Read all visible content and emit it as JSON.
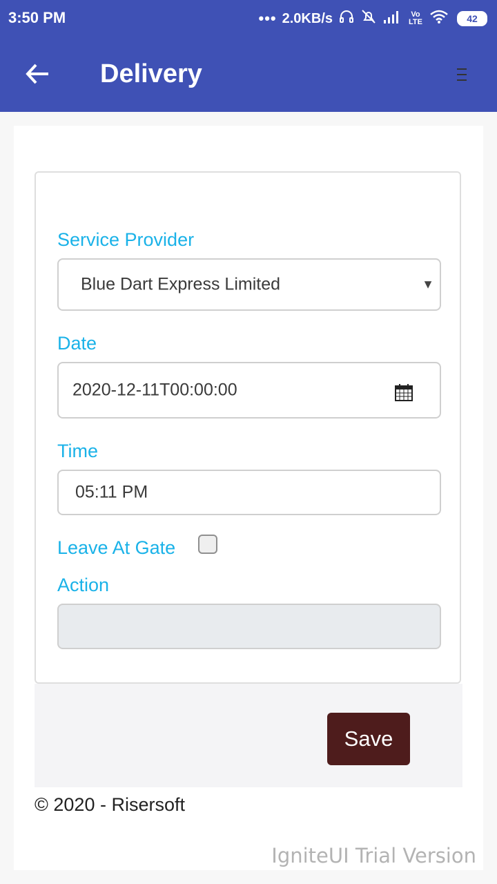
{
  "status_bar": {
    "time": "3:50 PM",
    "dots": "•••",
    "network_speed": "2.0KB/s",
    "icons": [
      "headset-icon",
      "mute-icon",
      "signal-icon",
      "volte-icon",
      "wifi-icon"
    ],
    "volte_label": "Vo LTE",
    "battery": "42"
  },
  "app_bar": {
    "title": "Delivery",
    "back_icon": "arrow-left-icon",
    "menu_icon": "hamburger-menu-icon",
    "color": "#3f51b5"
  },
  "form": {
    "service_provider": {
      "label": "Service Provider",
      "value": "Blue Dart Express Limited"
    },
    "date": {
      "label": "Date",
      "value": "2020-12-11T00:00:00"
    },
    "time": {
      "label": "Time",
      "value": "05:11 PM"
    },
    "leave_at_gate": {
      "label": "Leave At Gate",
      "checked": false
    },
    "action": {
      "label": "Action",
      "value": ""
    },
    "label_color": "#1ab2e8"
  },
  "save_label": "Save",
  "save_color": "#4e1c1c",
  "footer": {
    "copyright": "© 2020 - Risersoft"
  },
  "watermark": "IgniteUI Trial Version"
}
